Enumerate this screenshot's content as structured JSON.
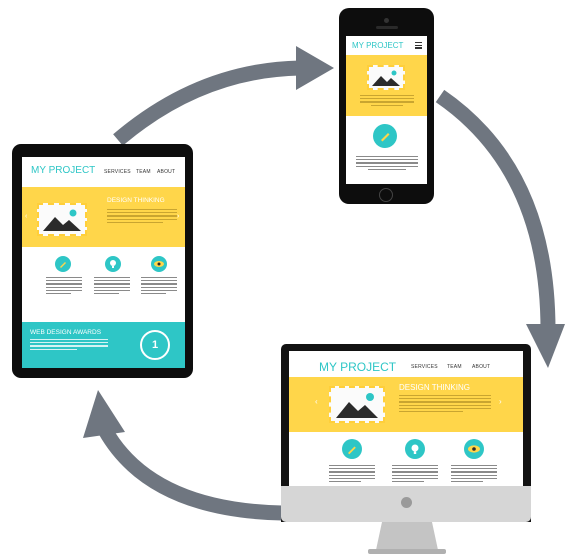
{
  "colors": {
    "accent": "#2ec6c6",
    "yellow": "#ffd64a",
    "arrow": "#6f7680",
    "device": "#0d0d0d"
  },
  "tablet": {
    "brand": "MY PROJECT",
    "nav": [
      "SERVICES",
      "TEAM",
      "ABOUT"
    ],
    "banner_title": "DESIGN THINKING",
    "icons": [
      "pencil-icon",
      "lightbulb-icon",
      "eye-icon"
    ],
    "awards_title": "WEB DESIGN AWARDS",
    "award_badge": "1"
  },
  "phone": {
    "brand": "MY PROJECT",
    "menu_icon": "hamburger-menu-icon",
    "icon": "pencil-icon"
  },
  "monitor": {
    "brand": "MY PROJECT",
    "nav": [
      "SERVICES",
      "TEAM",
      "ABOUT"
    ],
    "banner_title": "DESIGN THINKING",
    "icons": [
      "pencil-icon",
      "lightbulb-icon",
      "eye-icon"
    ]
  }
}
